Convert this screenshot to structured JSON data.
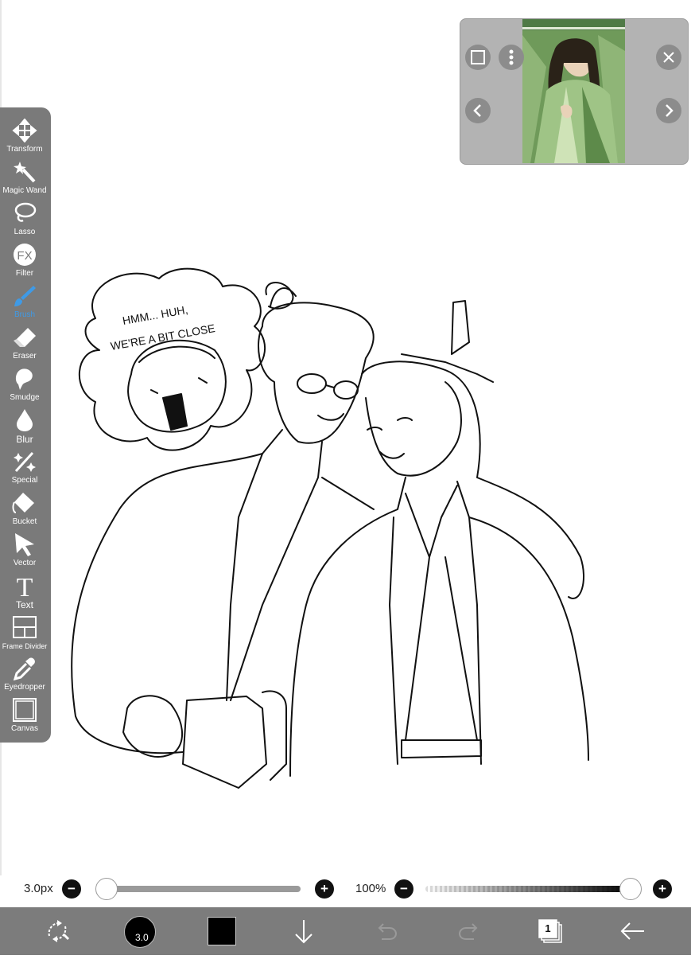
{
  "tools": [
    {
      "label": "Transform",
      "icon": "move-arrows-icon"
    },
    {
      "label": "Magic Wand",
      "icon": "magic-wand-icon"
    },
    {
      "label": "Lasso",
      "icon": "lasso-icon"
    },
    {
      "label": "Filter",
      "icon": "fx-icon",
      "glyph": "FX"
    },
    {
      "label": "Brush",
      "icon": "brush-icon",
      "active": true
    },
    {
      "label": "Eraser",
      "icon": "eraser-icon"
    },
    {
      "label": "Smudge",
      "icon": "smudge-icon"
    },
    {
      "label": "Blur",
      "icon": "drop-icon"
    },
    {
      "label": "Special",
      "icon": "sparkle-icon"
    },
    {
      "label": "Bucket",
      "icon": "bucket-icon"
    },
    {
      "label": "Vector",
      "icon": "cursor-arrow-icon"
    },
    {
      "label": "Text",
      "icon": "text-t-icon",
      "glyph": "T"
    },
    {
      "label": "Frame Divider",
      "icon": "frame-divider-icon"
    },
    {
      "label": "Eyedropper",
      "icon": "eyedropper-icon"
    },
    {
      "label": "Canvas",
      "icon": "canvas-square-icon"
    }
  ],
  "drawing_text": {
    "line1": "HMM... HUH,",
    "line2": "WE'RE A BIT CLOSE"
  },
  "sliders": {
    "brush_size_label": "3.0px",
    "brush_size_fraction": 0.0,
    "opacity_label": "100%",
    "opacity_fraction": 1.0,
    "minus": "−",
    "plus": "+"
  },
  "bottom_bar": {
    "brush_size_badge": "3.0",
    "layers_count": "1",
    "color": "#000000"
  },
  "colors": {
    "accent": "#3f9ae6",
    "toolbar_bg": "#7a7a7a",
    "bottom_bar_bg": "#7c7c7c"
  }
}
